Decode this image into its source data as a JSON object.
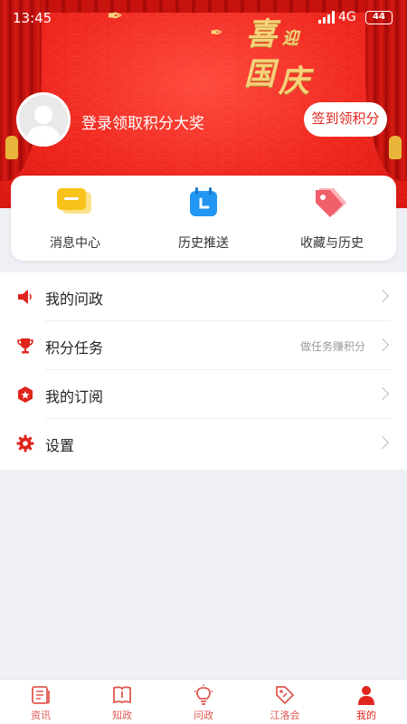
{
  "status_bar": {
    "time": "13:45",
    "network": "4G",
    "battery": "44"
  },
  "banner": {
    "festival_text": [
      "喜",
      "迎",
      "国",
      "庆"
    ],
    "login_prompt": "登录领取积分大奖",
    "signin_button": "签到领积分"
  },
  "quick_actions": [
    {
      "label": "消息中心",
      "icon": "message-center-icon",
      "color": "#f7c21a"
    },
    {
      "label": "历史推送",
      "icon": "history-push-icon",
      "color": "#2196f3"
    },
    {
      "label": "收藏与历史",
      "icon": "favorites-history-icon",
      "color": "#f0606a"
    }
  ],
  "menu": [
    {
      "label": "我的问政",
      "hint": "",
      "icon": "megaphone-icon"
    },
    {
      "label": "积分任务",
      "hint": "做任务赚积分",
      "icon": "trophy-icon"
    },
    {
      "label": "我的订阅",
      "hint": "",
      "icon": "subscription-icon"
    },
    {
      "label": "设置",
      "hint": "",
      "icon": "gear-icon"
    }
  ],
  "bottom_nav": [
    {
      "label": "资讯",
      "icon": "news-icon",
      "active": false
    },
    {
      "label": "知政",
      "icon": "book-icon",
      "active": false
    },
    {
      "label": "问政",
      "icon": "lightbulb-icon",
      "active": false
    },
    {
      "label": "江洛会",
      "icon": "tag-icon",
      "active": false
    },
    {
      "label": "我的",
      "icon": "person-icon",
      "active": true
    }
  ],
  "colors": {
    "primary_red": "#e0251c",
    "nav_inactive": "#e05a52",
    "page_bg": "#eef0f5"
  }
}
